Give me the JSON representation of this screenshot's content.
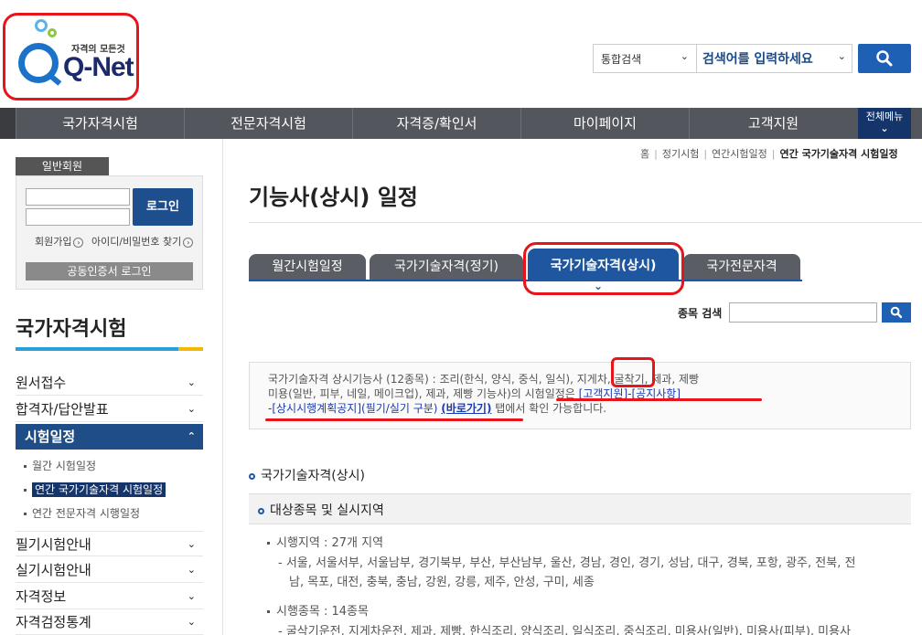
{
  "logo": {
    "slogan": "자격의 모든것",
    "name": "Q-Net"
  },
  "search": {
    "scope": "통합검색",
    "placeholder": "검색어를 입력하세요"
  },
  "nav": {
    "items": [
      "국가자격시험",
      "전문자격시험",
      "자격증/확인서",
      "마이페이지",
      "고객지원"
    ],
    "all_menu": "전체메뉴"
  },
  "login": {
    "tag": "일반회원",
    "button": "로그인",
    "join": "회원가입",
    "find": "아이디/비밀번호 찾기",
    "cert": "공동인증서 로그인"
  },
  "sidebar": {
    "title": "국가자격시험",
    "menu": [
      "원서접수",
      "합격자/답안발표"
    ],
    "active": "시험일정",
    "sub": [
      "월간 시험일정",
      "연간 국가기술자격 시험일정",
      "연간 전문자격 시행일정"
    ],
    "menu2": [
      "필기시험안내",
      "실기시험안내",
      "자격정보",
      "자격검정통계"
    ]
  },
  "breadcrumb": [
    "홈",
    "정기시험",
    "연간시험일정",
    "연간 국가기술자격 시험일정"
  ],
  "page_title": "기능사(상시) 일정",
  "tabs": [
    "월간시험일정",
    "국가기술자격(정기)",
    "국가기술자격(상시)",
    "국가전문자격"
  ],
  "filter": {
    "label": "종목 검색"
  },
  "notice": {
    "line1": "국가기술자격 상시기능사 (12종목) : 조리(한식, 양식, 중식, 일식), 지게차, 굴착기, 제과, 제빵",
    "line2a": "미용(일반, 피부, 네일, 메이크업), 제과, 제빵 기능사)의 시험일정은 ",
    "line2b": "[고객지원]-[공지사항]",
    "line3a": "-[상시시행계획공지](필기/실기 구분) ",
    "line3b": "(바로가기)",
    "line3c": " 탭에서 확인 가능합니다."
  },
  "section1": "국가기술자격(상시)",
  "section2": "대상종목 및 실시지역",
  "region": {
    "label": "시행지역 : 27개 지역",
    "list1": "- 서울, 서울서부, 서울남부, 경기북부, 부산, 부산남부, 울산, 경남, 경인, 경기, 성남, 대구, 경북, 포항, 광주, 전북, 전",
    "list2": "남, 목포, 대전, 충북, 충남, 강원, 강릉, 제주, 안성, 구미, 세종"
  },
  "subjects": {
    "label": "시행종목 : 14종목",
    "list1": "- 굴삭기운전, 지게차운전, 제과, 제빵, 한식조리, 양식조리, 일식조리, 중식조리, 미용사(일반), 미용사(피부), 미용사"
  }
}
